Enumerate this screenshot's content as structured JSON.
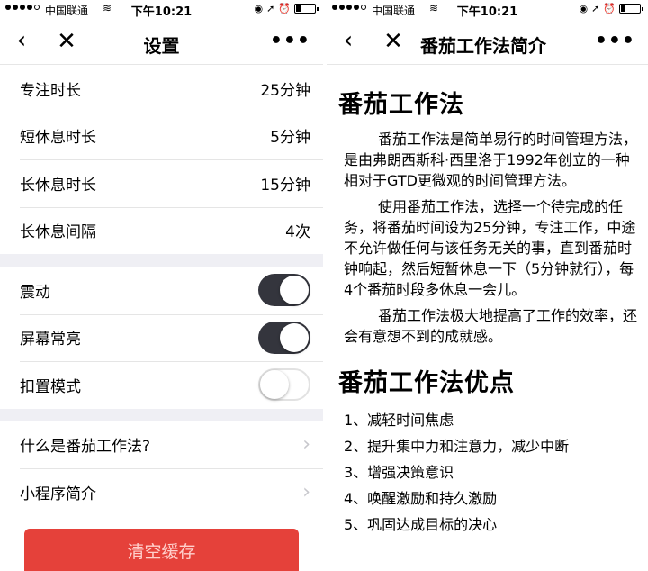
{
  "status": {
    "carrier": "中国联通",
    "time": "下午10:21"
  },
  "settings": {
    "title": "设置",
    "durations": [
      {
        "label": "专注时长",
        "value": "25分钟"
      },
      {
        "label": "短休息时长",
        "value": "5分钟"
      },
      {
        "label": "长休息时长",
        "value": "15分钟"
      },
      {
        "label": "长休息间隔",
        "value": "4次"
      }
    ],
    "toggles": [
      {
        "label": "震动",
        "on": true
      },
      {
        "label": "屏幕常亮",
        "on": true
      },
      {
        "label": "扣置模式",
        "on": false
      }
    ],
    "links": [
      {
        "label": "什么是番茄工作法?"
      },
      {
        "label": "小程序简介"
      }
    ],
    "clear_button": "清空缓存"
  },
  "intro": {
    "title": "番茄工作法简介",
    "heading1": "番茄工作法",
    "paragraphs": [
      "番茄工作法是简单易行的时间管理方法，是由弗朗西斯科·西里洛于1992年创立的一种相对于GTD更微观的时间管理方法。",
      "使用番茄工作法，选择一个待完成的任务，将番茄时间设为25分钟，专注工作，中途不允许做任何与该任务无关的事，直到番茄时钟响起，然后短暂休息一下（5分钟就行），每4个番茄时段多休息一会儿。",
      "番茄工作法极大地提高了工作的效率，还会有意想不到的成就感。"
    ],
    "heading2": "番茄工作法优点",
    "advantages": [
      "1、减轻时间焦虑",
      "2、提升集中力和注意力，减少中断",
      "3、增强决策意识",
      "4、唤醒激励和持久激励",
      "5、巩固达成目标的决心"
    ]
  },
  "colors": {
    "accent_red": "#e5413a",
    "toggle_on": "#34353d",
    "separator": "#efeff4"
  }
}
